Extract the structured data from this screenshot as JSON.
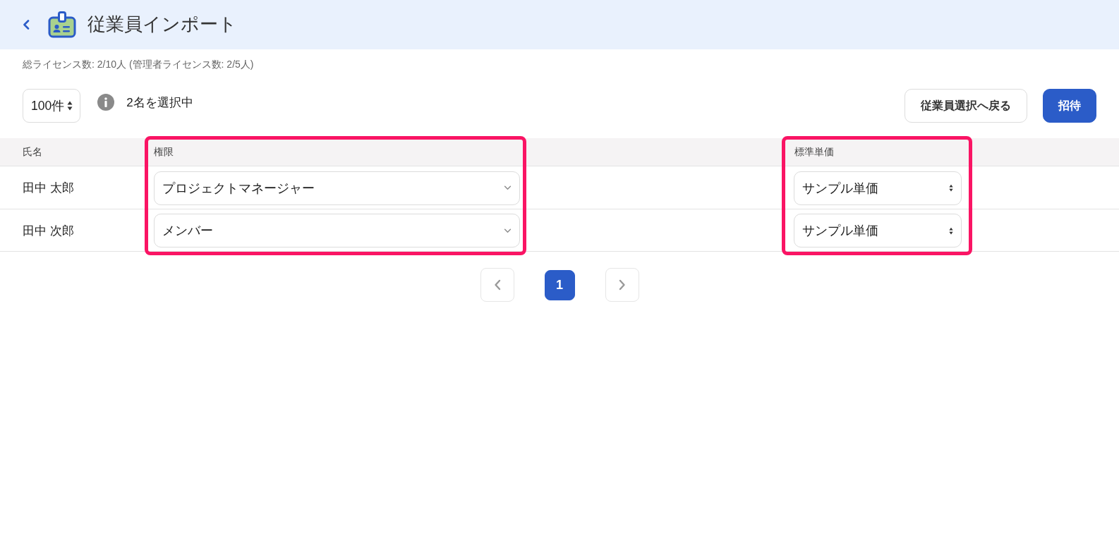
{
  "header": {
    "title": "従業員インポート"
  },
  "license_summary": "総ライセンス数: 2/10人 (管理者ライセンス数: 2/5人)",
  "toolbar": {
    "page_size": "100件",
    "selection_info": "2名を選択中",
    "buttons": [
      {
        "label": "従業員選択へ戻る",
        "kind": "secondary"
      },
      {
        "label": "招待",
        "kind": "primary"
      }
    ]
  },
  "table": {
    "columns": [
      {
        "label": "氏名",
        "highlighted": false
      },
      {
        "label": "権限",
        "highlighted": true
      },
      {
        "label": "標準単価",
        "highlighted": true
      }
    ],
    "rows": [
      {
        "name": "田中 太郎",
        "role": "プロジェクトマネージャー",
        "rate": "サンプル単価"
      },
      {
        "name": "田中 次郎",
        "role": "メンバー",
        "rate": "サンプル単価"
      }
    ]
  },
  "pagination": {
    "pages": [
      {
        "label": "1",
        "selected": true
      }
    ]
  }
}
